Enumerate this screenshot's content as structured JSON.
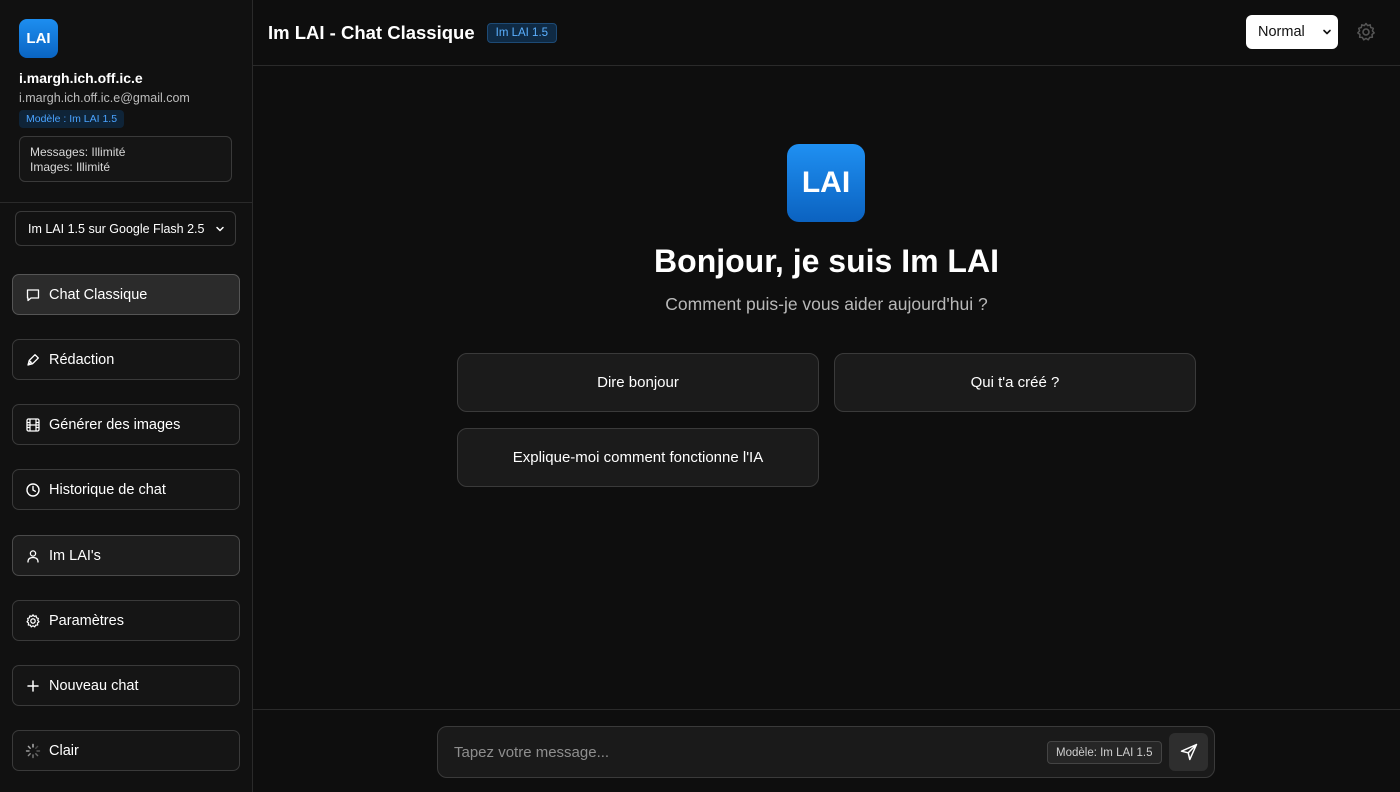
{
  "sidebar": {
    "logo_text": "LAI",
    "user_name": "i.margh.ich.off.ic.e",
    "user_email": "i.margh.ich.off.ic.e@gmail.com",
    "model_badge": "Modèle : Im LAI 1.5",
    "quota_messages": "Messages: Illimité",
    "quota_images": "Images: Illimité",
    "model_select": "Im LAI 1.5 sur Google Flash 2.5",
    "items": [
      {
        "label": "Chat Classique",
        "icon": "chat-icon"
      },
      {
        "label": "Rédaction",
        "icon": "pen-icon"
      },
      {
        "label": "Générer des images",
        "icon": "film-icon"
      },
      {
        "label": "Historique de chat",
        "icon": "clock-icon"
      },
      {
        "label": "Im LAI's",
        "icon": "user-icon"
      },
      {
        "label": "Paramètres",
        "icon": "gear-icon"
      },
      {
        "label": "Nouveau chat",
        "icon": "plus-icon"
      },
      {
        "label": "Clair",
        "icon": "loader-icon"
      }
    ]
  },
  "header": {
    "title": "Im LAI - Chat Classique",
    "badge": "Im LAI 1.5",
    "mode": "Normal"
  },
  "hero": {
    "logo_text": "LAI",
    "greeting": "Bonjour, je suis Im LAI",
    "subtitle": "Comment puis-je vous aider aujourd'hui ?"
  },
  "suggestions": [
    "Dire bonjour",
    "Qui t'a créé ?",
    "Explique-moi comment fonctionne l'IA"
  ],
  "composer": {
    "placeholder": "Tapez votre message...",
    "value": "",
    "model_tag": "Modèle: Im LAI 1.5"
  },
  "colors": {
    "background": "#0e0e0e",
    "sidebar": "#111111",
    "accent": "#1a7fe0",
    "badge_text": "#5bb0ff"
  }
}
